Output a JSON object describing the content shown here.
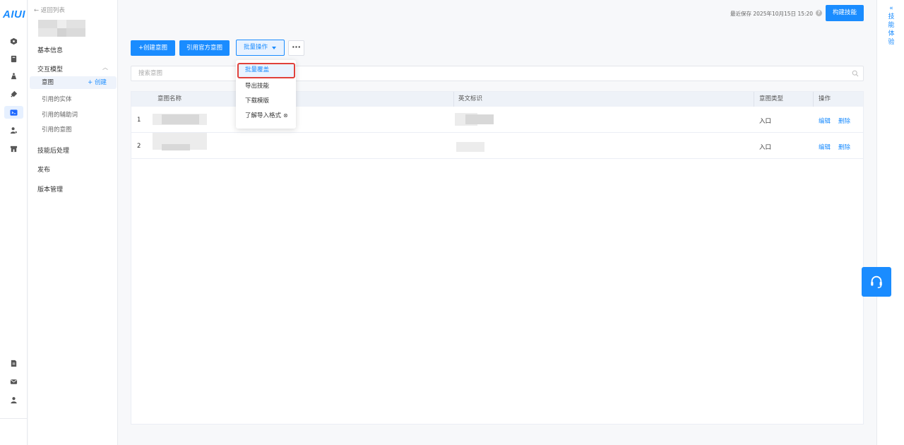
{
  "app": {
    "logo": "AIUI"
  },
  "nav": {
    "back": "← 返回列表",
    "items": {
      "basic_info": "基本信息",
      "interaction_model": "交互模型",
      "intent": "意图",
      "create": "+ 创建",
      "ref_entity": "引用的实体",
      "ref_aux": "引用的辅助词",
      "ref_intent": "引用的意图",
      "post_process": "技能后处理",
      "publish": "发布",
      "version": "版本管理"
    }
  },
  "header": {
    "last_save": "最近保存 2025年10月15日 15:20",
    "help": "?",
    "build": "构建技能"
  },
  "experience": {
    "label": "«技能体验",
    "chars": [
      "«",
      "技",
      "能",
      "体",
      "验"
    ]
  },
  "toolbar": {
    "create_intent": "+创建意图",
    "ref_official": "引用官方意图",
    "batch": "批量操作",
    "more": "···"
  },
  "search": {
    "placeholder": "搜索意图"
  },
  "table": {
    "columns": [
      "意图名称",
      "英文标识",
      "意图类型",
      "操作"
    ],
    "rows": [
      {
        "index": "1",
        "type": "入口",
        "edit": "编辑",
        "delete": "删除"
      },
      {
        "index": "2",
        "type": "入口",
        "edit": "编辑",
        "delete": "删除"
      }
    ]
  },
  "dropdown": {
    "items": [
      "批量覆盖",
      "导出技能",
      "下载模版",
      "了解导入格式"
    ],
    "help_icon": "⊗"
  },
  "colors": {
    "accent": "#1a8cff",
    "highlight_border": "#e0413b"
  }
}
